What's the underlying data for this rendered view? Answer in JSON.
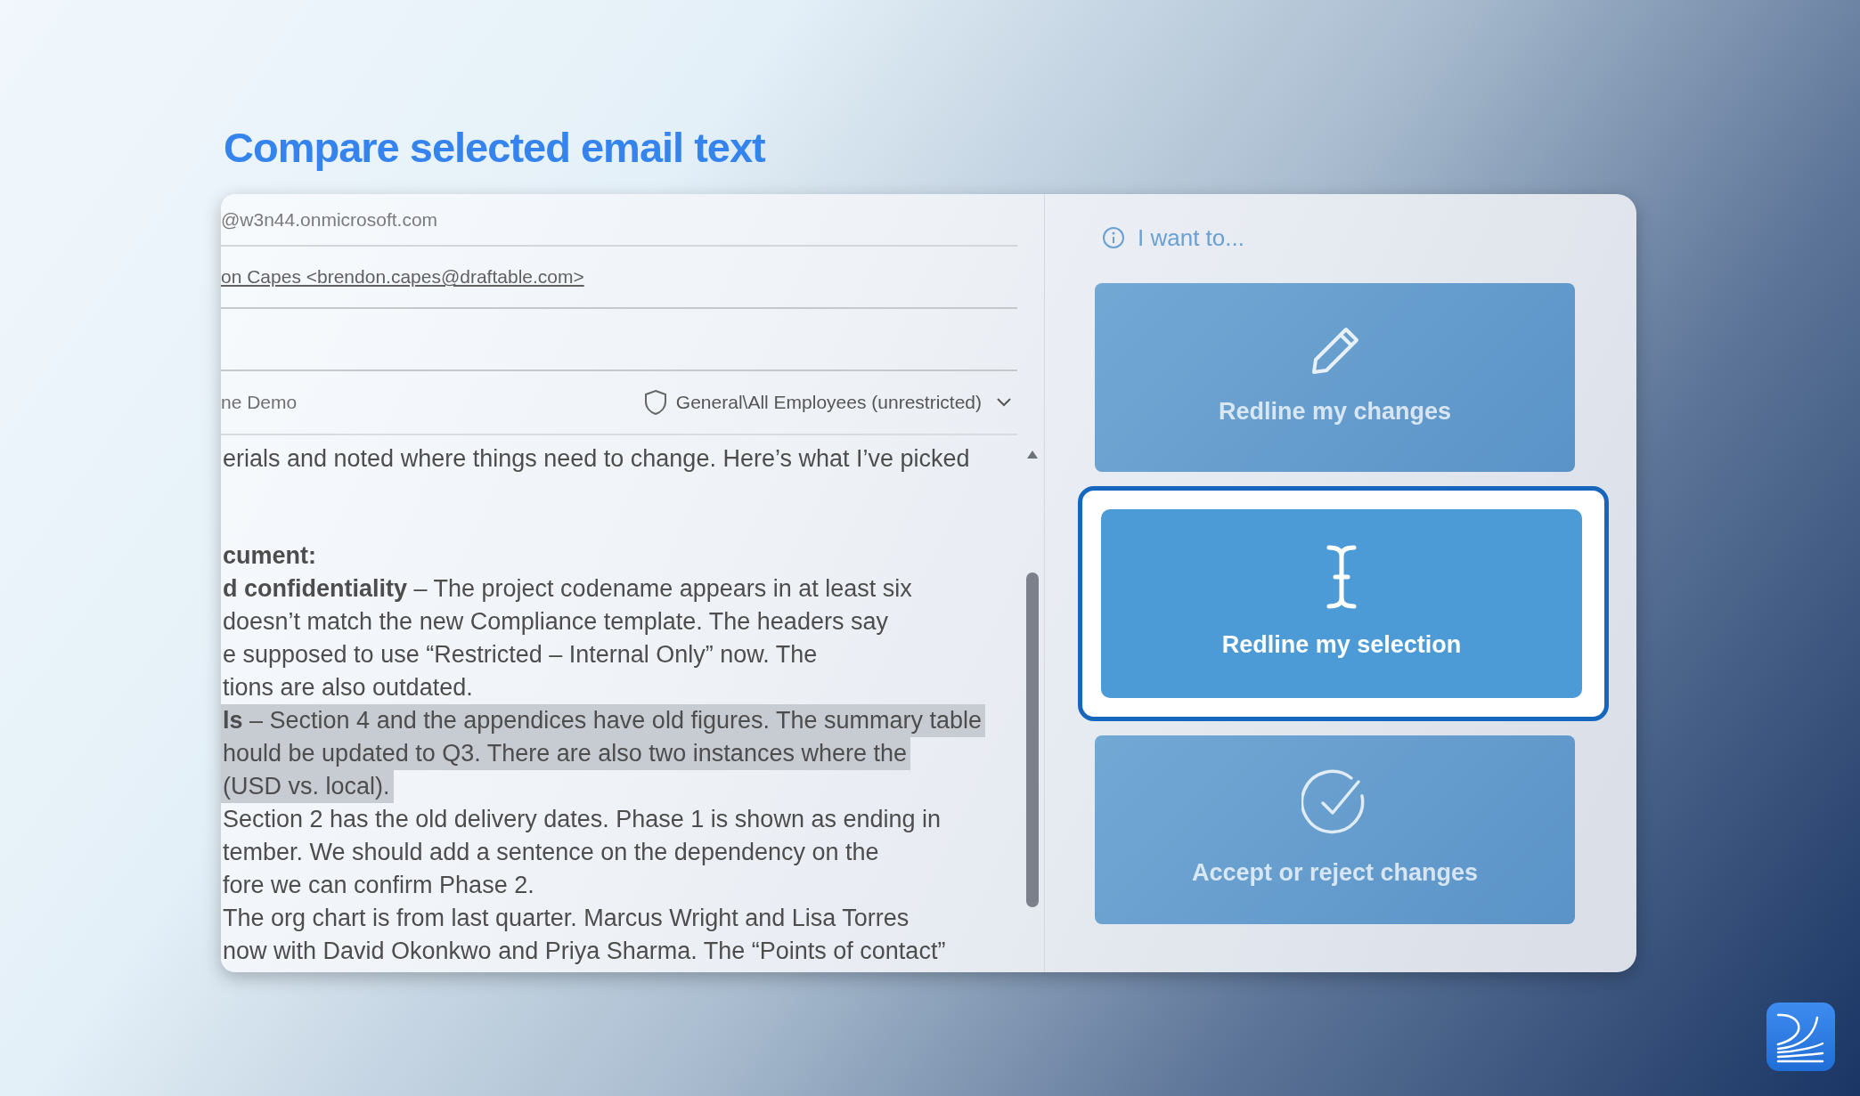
{
  "heading": "Compare selected email text",
  "email": {
    "from": "@w3n44.onmicrosoft.com",
    "to": "on Capes <brendon.capes@draftable.com>",
    "subject": "ne Demo",
    "sensitivity": "General\\All Employees (unrestricted)",
    "body": [
      {
        "text": "erials and noted where things need to change. Here’s what I’ve picked",
        "selected": false
      },
      {
        "text": "cument:",
        "kind": "heading",
        "selected": false
      },
      {
        "text": "**d confidentiality** – The project codename appears in at least six",
        "selected": false
      },
      {
        "text": "doesn’t match the new Compliance template. The headers say",
        "selected": false
      },
      {
        "text": "e supposed to use “Restricted – Internal Only” now. The",
        "selected": false
      },
      {
        "text": "tions are also outdated.",
        "selected": false
      },
      {
        "text": "**ls** – Section 4 and the appendices have old figures. The summary table",
        "selected": true
      },
      {
        "text": "hould be updated to Q3. There are also two instances where the",
        "selected": true
      },
      {
        "text": "(USD vs. local).",
        "selected": true
      },
      {
        "text": "Section 2 has the old delivery dates. Phase 1 is shown as ending in",
        "selected": false
      },
      {
        "text": "tember. We should add a sentence on the dependency on the",
        "selected": false
      },
      {
        "text": "fore we can confirm Phase 2.",
        "selected": false
      },
      {
        "text": "The org chart is from last quarter. Marcus Wright and Lisa Torres",
        "selected": false
      },
      {
        "text": "now with David Okonkwo and Priya Sharma. The “Points of contact”",
        "selected": false
      }
    ]
  },
  "panel": {
    "prompt": "I want to...",
    "actions": [
      {
        "label": "Redline my changes",
        "kind": "pencil",
        "selected": false
      },
      {
        "label": "Redline my selection",
        "kind": "cursor",
        "selected": true
      },
      {
        "label": "Accept or reject changes",
        "kind": "check",
        "selected": false
      }
    ]
  }
}
